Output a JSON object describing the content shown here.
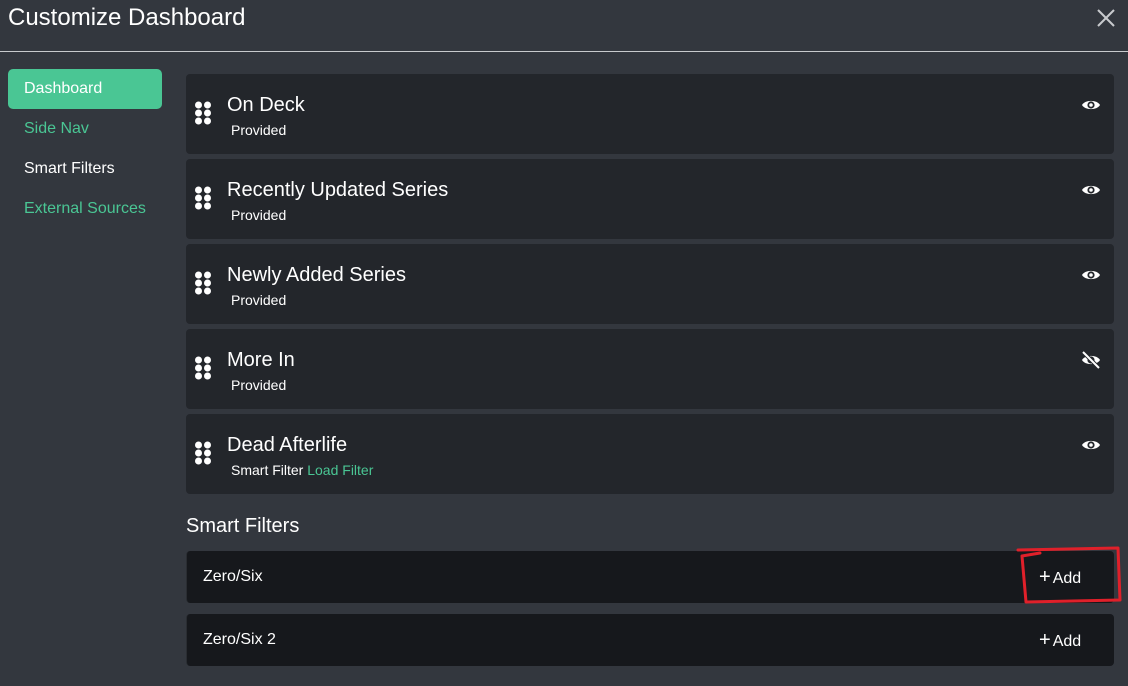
{
  "modal": {
    "title": "Customize Dashboard"
  },
  "sidebar": {
    "items": [
      {
        "label": "Dashboard"
      },
      {
        "label": "Side Nav"
      },
      {
        "label": "Smart Filters"
      },
      {
        "label": "External Sources"
      }
    ]
  },
  "streams": [
    {
      "name": "On Deck",
      "type": "Provided",
      "visible": true,
      "icon": "eye-icon"
    },
    {
      "name": "Recently Updated Series",
      "type": "Provided",
      "visible": true,
      "icon": "eye-icon"
    },
    {
      "name": "Newly Added Series",
      "type": "Provided",
      "visible": true,
      "icon": "eye-icon"
    },
    {
      "name": "More In",
      "type": "Provided",
      "visible": false,
      "icon": "eye-slash-icon"
    },
    {
      "name": "Dead Afterlife",
      "type": "Smart Filter",
      "link": "Load Filter",
      "visible": true,
      "icon": "eye-icon"
    }
  ],
  "smart_filters": {
    "title": "Smart Filters",
    "add_label": "Add",
    "items": [
      {
        "name": "Zero/Six"
      },
      {
        "name": "Zero/Six 2"
      }
    ]
  },
  "colors": {
    "accent": "#4ac694",
    "background": "#33373e",
    "card": "#23262b",
    "filter_card": "#16181c",
    "annotation": "#e0202a"
  }
}
